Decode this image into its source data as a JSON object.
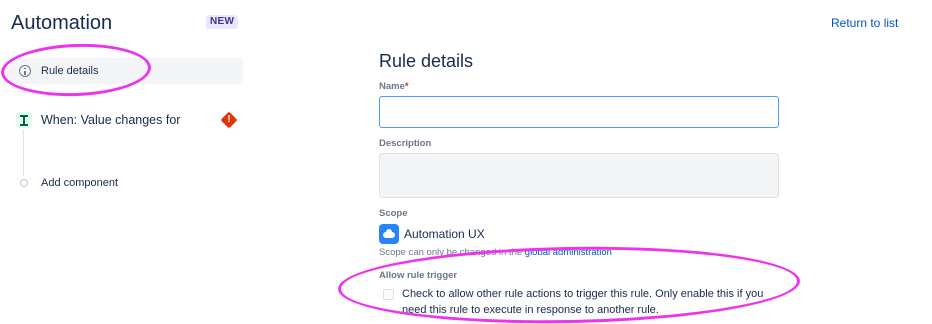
{
  "header": {
    "title": "Automation",
    "badge": "NEW",
    "return_link": "Return to list"
  },
  "sidebar": {
    "items": [
      {
        "label": "Rule details",
        "icon": "info-icon",
        "selected": true
      },
      {
        "label": "When: Value changes for",
        "icon": "trigger-icon",
        "status_icon": "error-icon"
      },
      {
        "label": "Add component",
        "icon": "add-dot-icon"
      }
    ]
  },
  "main": {
    "title": "Rule details",
    "name": {
      "label": "Name",
      "required_mark": "*",
      "value": ""
    },
    "description": {
      "label": "Description",
      "value": ""
    },
    "scope": {
      "label": "Scope",
      "project_name": "Automation UX",
      "note_prefix": "Scope can only be changed in the",
      "note_link": "global administration"
    },
    "allow_trigger": {
      "label": "Allow rule trigger",
      "checked": false,
      "text": "Check to allow other rule actions to trigger this rule. Only enable this if you need this rule to execute in response to another rule."
    }
  },
  "colors": {
    "accent": "#0052cc",
    "annotation": "#ee33ee",
    "error": "#de350b",
    "focus": "#4c9aff"
  }
}
